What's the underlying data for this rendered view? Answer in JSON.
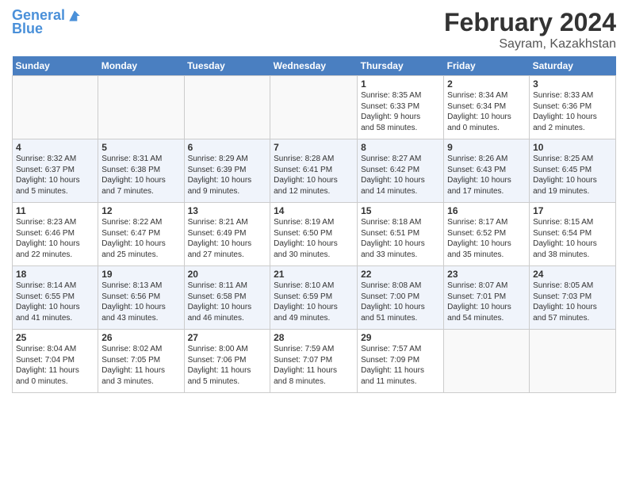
{
  "logo": {
    "line1": "General",
    "line2": "Blue"
  },
  "title": "February 2024",
  "location": "Sayram, Kazakhstan",
  "days_header": [
    "Sunday",
    "Monday",
    "Tuesday",
    "Wednesday",
    "Thursday",
    "Friday",
    "Saturday"
  ],
  "weeks": [
    [
      {
        "num": "",
        "detail": ""
      },
      {
        "num": "",
        "detail": ""
      },
      {
        "num": "",
        "detail": ""
      },
      {
        "num": "",
        "detail": ""
      },
      {
        "num": "1",
        "detail": "Sunrise: 8:35 AM\nSunset: 6:33 PM\nDaylight: 9 hours\nand 58 minutes."
      },
      {
        "num": "2",
        "detail": "Sunrise: 8:34 AM\nSunset: 6:34 PM\nDaylight: 10 hours\nand 0 minutes."
      },
      {
        "num": "3",
        "detail": "Sunrise: 8:33 AM\nSunset: 6:36 PM\nDaylight: 10 hours\nand 2 minutes."
      }
    ],
    [
      {
        "num": "4",
        "detail": "Sunrise: 8:32 AM\nSunset: 6:37 PM\nDaylight: 10 hours\nand 5 minutes."
      },
      {
        "num": "5",
        "detail": "Sunrise: 8:31 AM\nSunset: 6:38 PM\nDaylight: 10 hours\nand 7 minutes."
      },
      {
        "num": "6",
        "detail": "Sunrise: 8:29 AM\nSunset: 6:39 PM\nDaylight: 10 hours\nand 9 minutes."
      },
      {
        "num": "7",
        "detail": "Sunrise: 8:28 AM\nSunset: 6:41 PM\nDaylight: 10 hours\nand 12 minutes."
      },
      {
        "num": "8",
        "detail": "Sunrise: 8:27 AM\nSunset: 6:42 PM\nDaylight: 10 hours\nand 14 minutes."
      },
      {
        "num": "9",
        "detail": "Sunrise: 8:26 AM\nSunset: 6:43 PM\nDaylight: 10 hours\nand 17 minutes."
      },
      {
        "num": "10",
        "detail": "Sunrise: 8:25 AM\nSunset: 6:45 PM\nDaylight: 10 hours\nand 19 minutes."
      }
    ],
    [
      {
        "num": "11",
        "detail": "Sunrise: 8:23 AM\nSunset: 6:46 PM\nDaylight: 10 hours\nand 22 minutes."
      },
      {
        "num": "12",
        "detail": "Sunrise: 8:22 AM\nSunset: 6:47 PM\nDaylight: 10 hours\nand 25 minutes."
      },
      {
        "num": "13",
        "detail": "Sunrise: 8:21 AM\nSunset: 6:49 PM\nDaylight: 10 hours\nand 27 minutes."
      },
      {
        "num": "14",
        "detail": "Sunrise: 8:19 AM\nSunset: 6:50 PM\nDaylight: 10 hours\nand 30 minutes."
      },
      {
        "num": "15",
        "detail": "Sunrise: 8:18 AM\nSunset: 6:51 PM\nDaylight: 10 hours\nand 33 minutes."
      },
      {
        "num": "16",
        "detail": "Sunrise: 8:17 AM\nSunset: 6:52 PM\nDaylight: 10 hours\nand 35 minutes."
      },
      {
        "num": "17",
        "detail": "Sunrise: 8:15 AM\nSunset: 6:54 PM\nDaylight: 10 hours\nand 38 minutes."
      }
    ],
    [
      {
        "num": "18",
        "detail": "Sunrise: 8:14 AM\nSunset: 6:55 PM\nDaylight: 10 hours\nand 41 minutes."
      },
      {
        "num": "19",
        "detail": "Sunrise: 8:13 AM\nSunset: 6:56 PM\nDaylight: 10 hours\nand 43 minutes."
      },
      {
        "num": "20",
        "detail": "Sunrise: 8:11 AM\nSunset: 6:58 PM\nDaylight: 10 hours\nand 46 minutes."
      },
      {
        "num": "21",
        "detail": "Sunrise: 8:10 AM\nSunset: 6:59 PM\nDaylight: 10 hours\nand 49 minutes."
      },
      {
        "num": "22",
        "detail": "Sunrise: 8:08 AM\nSunset: 7:00 PM\nDaylight: 10 hours\nand 51 minutes."
      },
      {
        "num": "23",
        "detail": "Sunrise: 8:07 AM\nSunset: 7:01 PM\nDaylight: 10 hours\nand 54 minutes."
      },
      {
        "num": "24",
        "detail": "Sunrise: 8:05 AM\nSunset: 7:03 PM\nDaylight: 10 hours\nand 57 minutes."
      }
    ],
    [
      {
        "num": "25",
        "detail": "Sunrise: 8:04 AM\nSunset: 7:04 PM\nDaylight: 11 hours\nand 0 minutes."
      },
      {
        "num": "26",
        "detail": "Sunrise: 8:02 AM\nSunset: 7:05 PM\nDaylight: 11 hours\nand 3 minutes."
      },
      {
        "num": "27",
        "detail": "Sunrise: 8:00 AM\nSunset: 7:06 PM\nDaylight: 11 hours\nand 5 minutes."
      },
      {
        "num": "28",
        "detail": "Sunrise: 7:59 AM\nSunset: 7:07 PM\nDaylight: 11 hours\nand 8 minutes."
      },
      {
        "num": "29",
        "detail": "Sunrise: 7:57 AM\nSunset: 7:09 PM\nDaylight: 11 hours\nand 11 minutes."
      },
      {
        "num": "",
        "detail": ""
      },
      {
        "num": "",
        "detail": ""
      }
    ]
  ]
}
